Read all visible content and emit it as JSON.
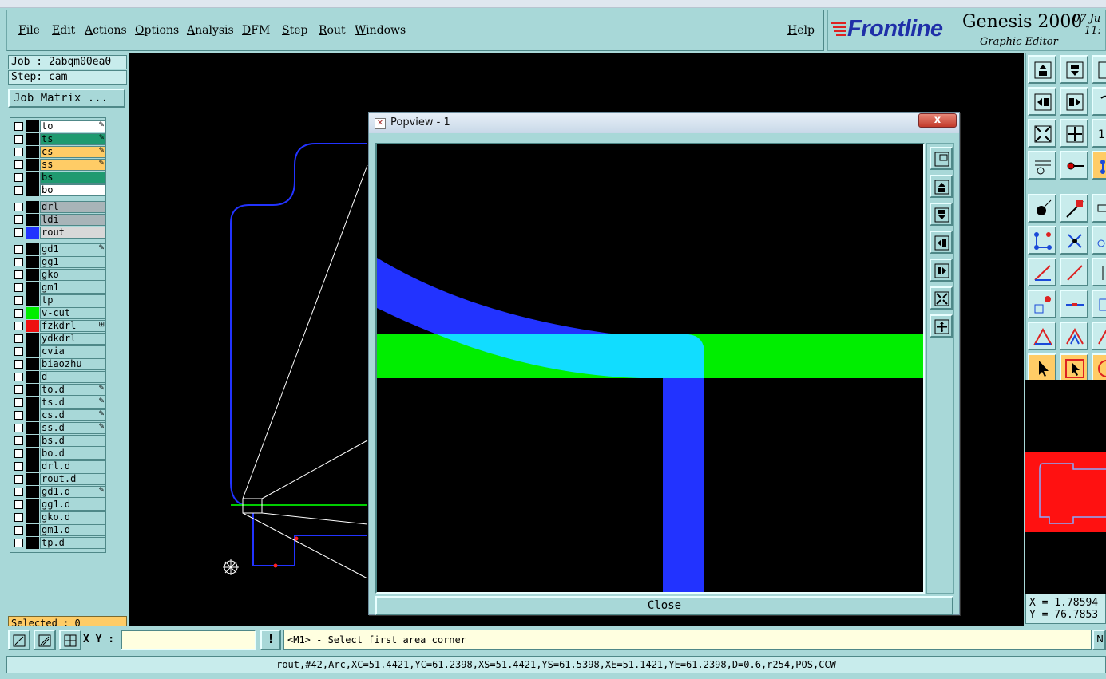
{
  "menu": [
    "File",
    "Edit",
    "Actions",
    "Options",
    "Analysis",
    "DFM",
    "Step",
    "Rout",
    "Windows"
  ],
  "help_label": "Help",
  "brand": {
    "logo": "Frontline",
    "title": "Genesis 2000",
    "subtitle": "Graphic Editor",
    "date_line1": "07 Ju",
    "date_line2": "11:"
  },
  "job": {
    "job_text": "Job : 2abqm00ea0",
    "step_text": "Step: cam",
    "matrix_button": "Job Matrix ..."
  },
  "layers": [
    {
      "name": "to",
      "color": "#000000",
      "bg": "#ffffff",
      "mark": "✎"
    },
    {
      "name": "ts",
      "color": "#000000",
      "bg": "#1f9a70",
      "mark": "✎"
    },
    {
      "name": "cs",
      "color": "#000000",
      "bg": "#ffcc66",
      "mark": "✎"
    },
    {
      "name": "ss",
      "color": "#000000",
      "bg": "#ffcc66",
      "mark": "✎"
    },
    {
      "name": "bs",
      "color": "#000000",
      "bg": "#1f9a70",
      "mark": ""
    },
    {
      "name": "bo",
      "color": "#000000",
      "bg": "#ffffff",
      "mark": ""
    },
    {
      "name": "drl",
      "color": "#000000",
      "bg": "#a8b4b8",
      "mark": ""
    },
    {
      "name": "ldi",
      "color": "#000000",
      "bg": "#a8b4b8",
      "mark": ""
    },
    {
      "name": "rout",
      "color": "#2233ff",
      "bg": "#d8d8d8",
      "mark": ""
    },
    {
      "name": "gd1",
      "color": "#000000",
      "bg": "#a8d8d8",
      "mark": "✎"
    },
    {
      "name": "gg1",
      "color": "#000000",
      "bg": "#a8d8d8",
      "mark": ""
    },
    {
      "name": "gko",
      "color": "#000000",
      "bg": "#a8d8d8",
      "mark": ""
    },
    {
      "name": "gm1",
      "color": "#000000",
      "bg": "#a8d8d8",
      "mark": ""
    },
    {
      "name": "tp",
      "color": "#000000",
      "bg": "#a8d8d8",
      "mark": ""
    },
    {
      "name": "v-cut",
      "color": "#00ee00",
      "bg": "#a8d8d8",
      "mark": ""
    },
    {
      "name": "fzkdrl",
      "color": "#ee1111",
      "bg": "#a8d8d8",
      "mark": "⊞"
    },
    {
      "name": "ydkdrl",
      "color": "#000000",
      "bg": "#a8d8d8",
      "mark": ""
    },
    {
      "name": "cvia",
      "color": "#000000",
      "bg": "#a8d8d8",
      "mark": ""
    },
    {
      "name": "biaozhu",
      "color": "#000000",
      "bg": "#a8d8d8",
      "mark": ""
    },
    {
      "name": "d",
      "color": "#000000",
      "bg": "#a8d8d8",
      "mark": ""
    },
    {
      "name": "to.d",
      "color": "#000000",
      "bg": "#a8d8d8",
      "mark": "✎"
    },
    {
      "name": "ts.d",
      "color": "#000000",
      "bg": "#a8d8d8",
      "mark": "✎"
    },
    {
      "name": "cs.d",
      "color": "#000000",
      "bg": "#a8d8d8",
      "mark": "✎"
    },
    {
      "name": "ss.d",
      "color": "#000000",
      "bg": "#a8d8d8",
      "mark": "✎"
    },
    {
      "name": "bs.d",
      "color": "#000000",
      "bg": "#a8d8d8",
      "mark": ""
    },
    {
      "name": "bo.d",
      "color": "#000000",
      "bg": "#a8d8d8",
      "mark": ""
    },
    {
      "name": "drl.d",
      "color": "#000000",
      "bg": "#a8d8d8",
      "mark": ""
    },
    {
      "name": "rout.d",
      "color": "#000000",
      "bg": "#a8d8d8",
      "mark": ""
    },
    {
      "name": "gd1.d",
      "color": "#000000",
      "bg": "#a8d8d8",
      "mark": "✎"
    },
    {
      "name": "gg1.d",
      "color": "#000000",
      "bg": "#a8d8d8",
      "mark": ""
    },
    {
      "name": "gko.d",
      "color": "#000000",
      "bg": "#a8d8d8",
      "mark": ""
    },
    {
      "name": "gm1.d",
      "color": "#000000",
      "bg": "#a8d8d8",
      "mark": ""
    },
    {
      "name": "tp.d",
      "color": "#000000",
      "bg": "#a8d8d8",
      "mark": ""
    }
  ],
  "selected_text": "Selected : 0",
  "popview": {
    "title": "Popview - 1",
    "close_x": "x",
    "close_button": "Close"
  },
  "coords": {
    "x": "X = 1.78594",
    "y": "Y = 76.7853"
  },
  "bottom": {
    "xy_label": "X Y :",
    "xy_value": "",
    "bang": "!",
    "prompt": "<M1> - Select first area corner",
    "prompt_right": "N"
  },
  "status_line": "rout,#42,Arc,XC=51.4421,YC=61.2398,XS=51.4421,YS=61.5398,XE=51.1421,YE=61.2398,D=0.6,r254,POS,CCW"
}
